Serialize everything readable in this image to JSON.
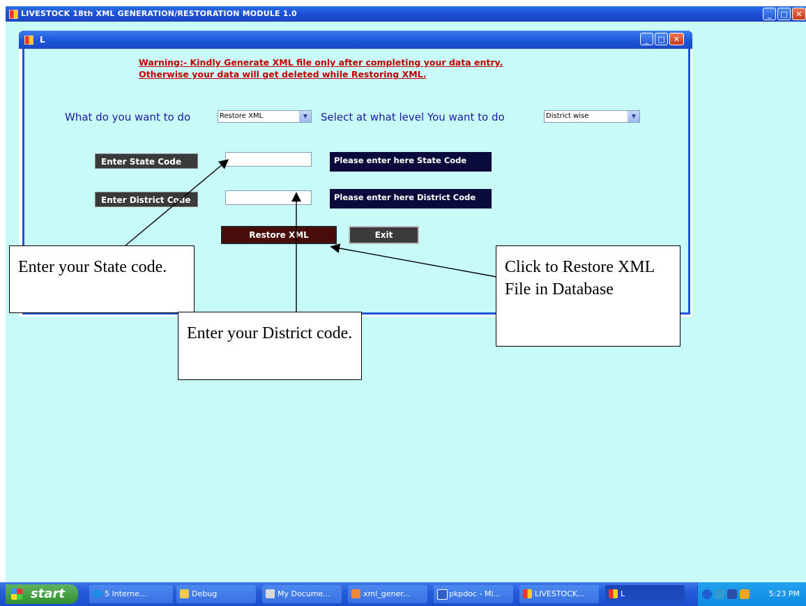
{
  "outer_window": {
    "title": "LIVESTOCK 18th XML GENERATION/RESTORATION MODULE 1.0"
  },
  "inner_window": {
    "title": "L",
    "warning_line1": "Warning:- Kindly Generate XML file only after completing your data entry.",
    "warning_line2": "Otherwise your data will get deleted while Restoring XML.",
    "what_label": "What do you want to do",
    "what_select_value": "Restore XML",
    "level_label": "Select at what level You want to do",
    "level_select_value": "District wise",
    "state_label": "Enter State Code",
    "state_value": "",
    "state_hint": "Please enter here State Code",
    "district_label": "Enter District Code",
    "district_value": "",
    "district_hint": "Please enter here District Code",
    "restore_button": "Restore XML",
    "exit_button": "Exit"
  },
  "callouts": {
    "state": "Enter your State code.",
    "district": "Enter your District code.",
    "restore": "Click to Restore XML File in Database"
  },
  "taskbar": {
    "start_label": "start",
    "items": [
      {
        "label": "5 Interne...",
        "icon": "ie-icon"
      },
      {
        "label": "Debug",
        "icon": "folder-icon"
      },
      {
        "label": "My Docume...",
        "icon": "my-documents-icon"
      },
      {
        "label": "xml_gener...",
        "icon": "app-icon"
      },
      {
        "label": "pkpdoc - Mi...",
        "icon": "word-icon"
      },
      {
        "label": "LIVESTOCK...",
        "icon": "app-icon"
      },
      {
        "label": "L",
        "icon": "app-icon"
      }
    ],
    "clock": "5:23 PM"
  }
}
